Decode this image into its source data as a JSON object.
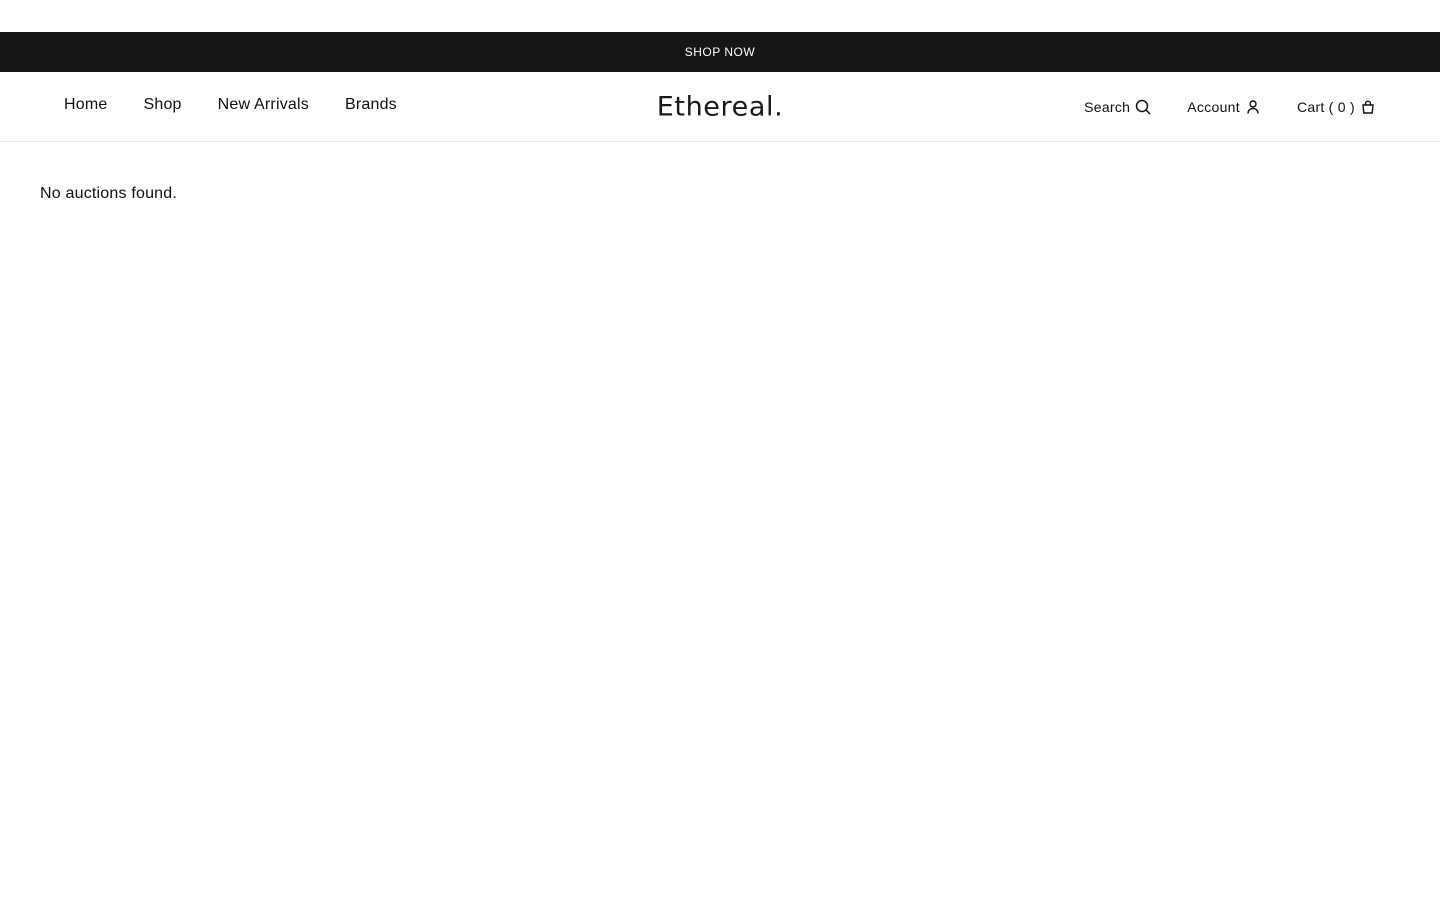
{
  "announcement": {
    "text": "SHOP NOW"
  },
  "nav": {
    "items": [
      {
        "label": "Home"
      },
      {
        "label": "Shop"
      },
      {
        "label": "New Arrivals"
      },
      {
        "label": "Brands"
      }
    ]
  },
  "logo": {
    "text": "Ethereal."
  },
  "utilities": {
    "search_label": "Search",
    "search_icon": "search-icon",
    "account_label": "Account",
    "account_icon": "user-icon",
    "cart_label": "Cart",
    "cart_count_display": "( 0 )",
    "cart_icon": "shopping-bag-icon"
  },
  "main": {
    "empty_message": "No auctions found."
  },
  "colors": {
    "announcement_bg": "#161616",
    "text": "#111111",
    "divider": "#e8e8e8"
  }
}
